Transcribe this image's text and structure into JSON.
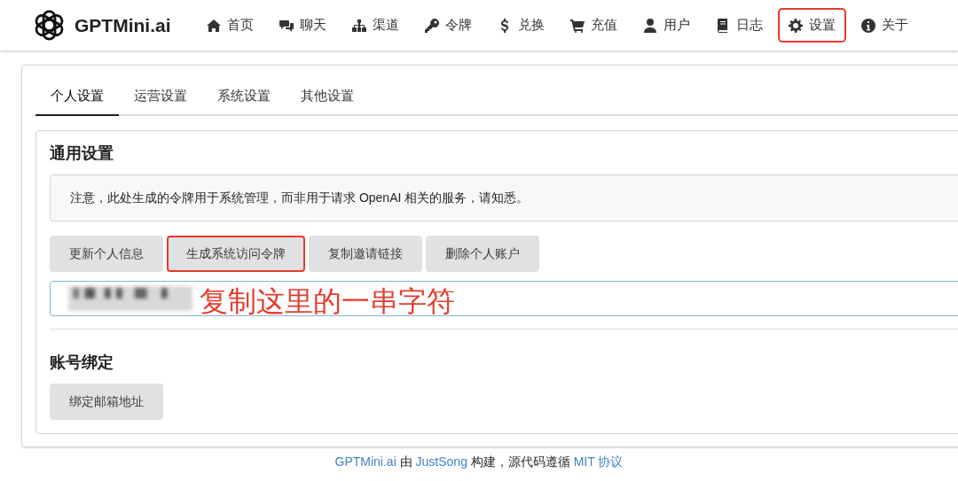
{
  "brand": {
    "name": "GPTMini.ai"
  },
  "nav": [
    {
      "label": "首页",
      "kind": "home",
      "highlighted": false
    },
    {
      "label": "聊天",
      "kind": "chat",
      "highlighted": false
    },
    {
      "label": "渠道",
      "kind": "sitemap",
      "highlighted": false
    },
    {
      "label": "令牌",
      "kind": "key",
      "highlighted": false
    },
    {
      "label": "兑换",
      "kind": "dollar",
      "highlighted": false
    },
    {
      "label": "充值",
      "kind": "cart",
      "highlighted": false
    },
    {
      "label": "用户",
      "kind": "user",
      "highlighted": false
    },
    {
      "label": "日志",
      "kind": "book",
      "highlighted": false
    },
    {
      "label": "设置",
      "kind": "gear",
      "highlighted": true
    },
    {
      "label": "关于",
      "kind": "info",
      "highlighted": false
    }
  ],
  "tabs": [
    {
      "label": "个人设置",
      "selected": true
    },
    {
      "label": "运营设置",
      "selected": false
    },
    {
      "label": "系统设置",
      "selected": false
    },
    {
      "label": "其他设置",
      "selected": false
    }
  ],
  "general": {
    "title": "通用设置",
    "notice": "注意，此处生成的令牌用于系统管理，而非用于请求 OpenAI 相关的服务，请知悉。",
    "buttons": [
      {
        "label": "更新个人信息",
        "highlighted": false
      },
      {
        "label": "生成系统访问令牌",
        "highlighted": true
      },
      {
        "label": "复制邀请链接",
        "highlighted": false
      },
      {
        "label": "删除个人账户",
        "highlighted": false
      }
    ],
    "annotation": "复制这里的一串字符"
  },
  "binding": {
    "title": "账号绑定",
    "buttons": [
      {
        "label": "绑定邮箱地址",
        "highlighted": false
      }
    ]
  },
  "footer": [
    {
      "kind": "link",
      "text": "GPTMini.ai"
    },
    {
      "kind": "text",
      "text": " 由 "
    },
    {
      "kind": "link",
      "text": "JustSong"
    },
    {
      "kind": "text",
      "text": " 构建，源代码遵循 "
    },
    {
      "kind": "link",
      "text": "MIT 协议"
    }
  ]
}
